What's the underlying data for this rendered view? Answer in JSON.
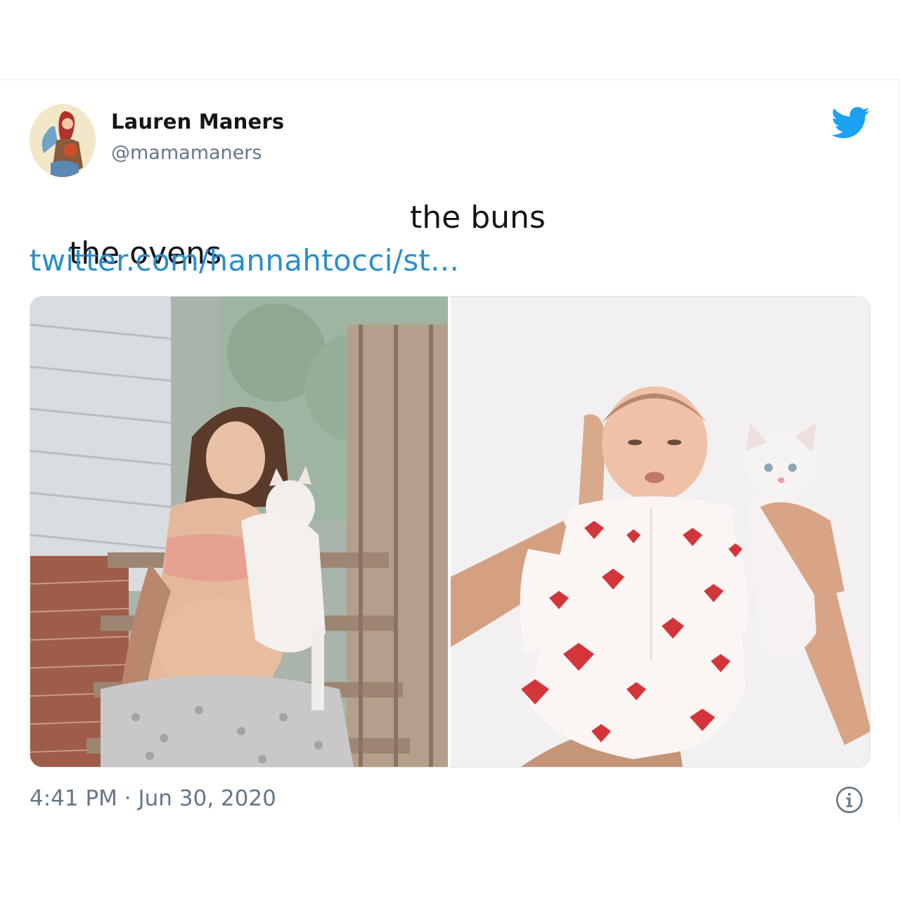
{
  "author": {
    "name": "Lauren Maners",
    "handle": "@mamamaners"
  },
  "tweet": {
    "text_left": "the ovens",
    "text_right": "the buns",
    "link": "twitter.com/hannahtocci/st..."
  },
  "meta": {
    "timestamp": "4:41 PM · Jun 30, 2020"
  },
  "icons": {
    "platform": "twitter-bird-icon",
    "info": "info-icon"
  },
  "colors": {
    "brand": "#1da1f2",
    "link": "#2a8fc9",
    "secondary_text": "#657786"
  }
}
